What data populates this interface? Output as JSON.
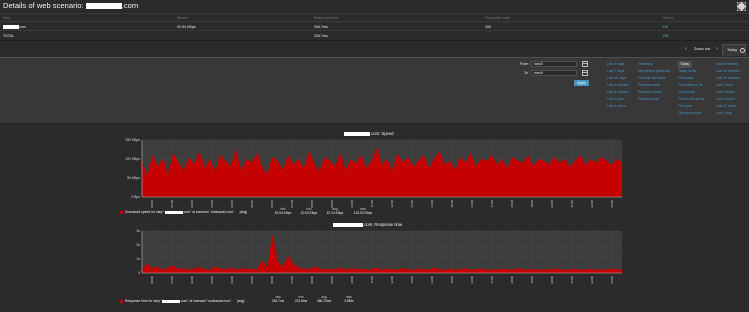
{
  "window": {
    "title_prefix": "Details of web scenario: ",
    "title_suffix": ".com"
  },
  "table": {
    "headers": [
      "Step",
      "Speed",
      "Response time",
      "Response code",
      "Status"
    ],
    "rows": [
      {
        "step_suffix": "com",
        "speed": "92.94 KBps",
        "response_time": "334.7ms",
        "response_code": "200",
        "status": "OK"
      },
      {
        "step": "TOTAL",
        "speed": "",
        "response_time": "334.7ms",
        "response_code": "",
        "status": "OK"
      }
    ]
  },
  "zoombar": {
    "prev": "‹",
    "zoom_out": "Zoom out",
    "next": "›",
    "active_tab": "Today"
  },
  "filter": {
    "from_label": "From",
    "from_value": "now/d",
    "to_label": "To",
    "to_value": "now/d",
    "apply_label": "Apply",
    "quick_ranges": [
      [
        "Last 2 days",
        "Last 7 days",
        "Last 30 days",
        "Last 3 months",
        "Last 6 months",
        "Last 1 year",
        "Last 2 years"
      ],
      [
        "Yesterday",
        "Day before yesterday",
        "This day last week",
        "Previous week",
        "Previous month",
        "Previous year"
      ],
      [
        "Today",
        "Today so far",
        "This week",
        "This week so far",
        "This month",
        "This month so far",
        "This year",
        "This year so far"
      ],
      [
        "Last 5 minutes",
        "Last 15 minutes",
        "Last 30 minutes",
        "Last 1 hour",
        "Last 3 hours",
        "Last 6 hours",
        "Last 12 hours",
        "Last 1 day"
      ]
    ],
    "selected": "Today"
  },
  "graphs": [
    {
      "title_suffix": ".com: Speed",
      "legend_prefix": "Download speed for step \"",
      "legend_suffix": ".com\" of scenario \"codeswat.com\".",
      "legend_agg": "[avg]",
      "stats": [
        {
          "k": "last",
          "v": "92.94 KBps"
        },
        {
          "k": "min",
          "v": "10.63 KBps"
        },
        {
          "k": "avg",
          "v": "87.44 KBps"
        },
        {
          "k": "max",
          "v": "133.92 KBps"
        }
      ]
    },
    {
      "title_suffix": ".com: Response time",
      "legend_prefix": "Response time for step \"",
      "legend_suffix": ".com\" of scenario \"codeswat.com\".",
      "legend_agg": "[avg]",
      "stats": [
        {
          "k": "last",
          "v": "334.7ms"
        },
        {
          "k": "min",
          "v": "224.8ms"
        },
        {
          "k": "avg",
          "v": "466.23ms"
        },
        {
          "k": "max",
          "v": "3.584s"
        }
      ]
    }
  ],
  "chart_data": [
    {
      "type": "area",
      "title": ".com: Speed",
      "ylim": [
        0,
        150
      ],
      "yticks": [
        "0 Bps",
        "50 KBps",
        "100 KBps",
        "150 KBps"
      ],
      "grid": true,
      "x": [
        "00:00",
        "01:00",
        "02:00",
        "03:00",
        "04:00",
        "05:00",
        "06:00",
        "07:00",
        "08:00",
        "09:00",
        "10:00",
        "11:00",
        "12:00",
        "13:00",
        "14:00",
        "15:00",
        "16:00",
        "17:00",
        "18:00",
        "19:00",
        "20:00",
        "21:00",
        "22:00",
        "23:00"
      ],
      "series": [
        {
          "color": "#c40000",
          "values": [
            95,
            55,
            110,
            80,
            100,
            60,
            115,
            90,
            70,
            105,
            85,
            120,
            75,
            100,
            65,
            110,
            95,
            80,
            125,
            70,
            100,
            90,
            115,
            80,
            60,
            105,
            95,
            70,
            110,
            85,
            100,
            75,
            120,
            90,
            65,
            105,
            95,
            80,
            115,
            70,
            100,
            88,
            110,
            75,
            95,
            130,
            85,
            100,
            70,
            115,
            90,
            105,
            80,
            95,
            110,
            75,
            100,
            120,
            85,
            95,
            70,
            105,
            90,
            115,
            80,
            100,
            95,
            110,
            85,
            100,
            75,
            105,
            95,
            90,
            110,
            80,
            100,
            95,
            85,
            105,
            90,
            100,
            80,
            95,
            110,
            85,
            100,
            90,
            105,
            95,
            85,
            100,
            92
          ]
        }
      ]
    },
    {
      "type": "area",
      "title": ".com: Response time",
      "ylim": [
        0,
        4
      ],
      "yticks": [
        "0",
        "1s",
        "2s",
        "3s"
      ],
      "grid": true,
      "x": [
        "00:00",
        "01:00",
        "02:00",
        "03:00",
        "04:00",
        "05:00",
        "06:00",
        "07:00",
        "08:00",
        "09:00",
        "10:00",
        "11:00",
        "12:00",
        "13:00",
        "14:00",
        "15:00",
        "16:00",
        "17:00",
        "18:00",
        "19:00",
        "20:00",
        "21:00",
        "22:00",
        "23:00"
      ],
      "series": [
        {
          "color": "#c40000",
          "values": [
            0.35,
            0.9,
            0.4,
            0.6,
            0.3,
            0.5,
            0.7,
            0.35,
            0.45,
            0.3,
            0.4,
            0.55,
            0.35,
            0.3,
            0.6,
            0.4,
            0.35,
            0.5,
            0.3,
            0.45,
            0.35,
            0.4,
            0.3,
            1.2,
            0.5,
            3.58,
            1.1,
            0.6,
            1.6,
            0.9,
            0.5,
            0.4,
            0.35,
            0.6,
            0.45,
            0.3,
            0.4,
            0.35,
            0.5,
            0.3,
            0.45,
            0.35,
            0.4,
            0.3,
            0.35,
            0.5,
            0.3,
            0.4,
            0.35,
            0.3,
            0.45,
            0.35,
            0.3,
            0.4,
            0.35,
            0.3,
            0.5,
            0.35,
            0.3,
            0.4,
            0.3,
            0.35,
            0.45,
            0.3,
            0.35,
            0.4,
            0.3,
            0.35,
            0.3,
            0.4,
            0.35,
            0.3,
            0.45,
            0.35,
            0.3,
            0.4,
            0.3,
            0.35,
            0.3,
            0.4,
            0.35,
            0.3,
            0.35,
            0.4,
            0.3,
            0.35,
            0.4,
            0.3,
            0.35,
            0.3,
            0.4,
            0.35,
            0.33
          ]
        }
      ]
    }
  ]
}
